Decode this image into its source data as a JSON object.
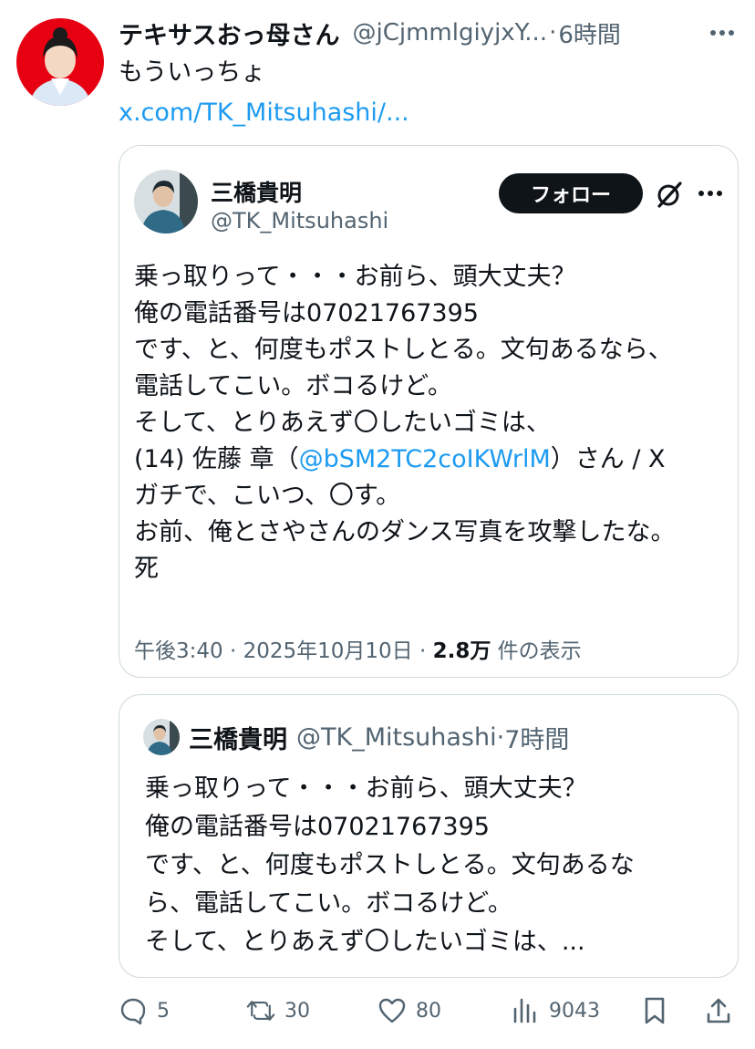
{
  "tweet": {
    "display_name": "テキサスおっ母さん",
    "handle": "@jCjmmlgiyjxY...",
    "time": "6時間",
    "text": "もういっちょ",
    "link": "x.com/TK_Mitsuhashi/..."
  },
  "embedded": {
    "display_name": "三橋貴明",
    "handle": "@TK_Mitsuhashi",
    "follow_label": "フォロー",
    "lines": [
      "乗っ取りって・・・お前ら、頭大丈夫？",
      "俺の電話番号は07021767395",
      "です、と、何度もポストしとる。文句あるなら、",
      "電話してこい。ボコるけど。",
      "そして、とりあえず〇したいゴミは、"
    ],
    "line6_prefix": "(14) 佐藤 章（",
    "mention": "@bSM2TC2coIKWrlM",
    "line6_suffix": "）さん / X",
    "lines_after": [
      "ガチで、こいつ、〇す。",
      "お前、俺とさやさんのダンス写真を攻撃したな。",
      "死"
    ],
    "meta_time": "午後3:40 · 2025年10月10日 · ",
    "meta_views": "2.8万",
    "meta_views_label": " 件の表示"
  },
  "quoted": {
    "display_name": "三橋貴明",
    "handle": "@TK_Mitsuhashi",
    "time": "7時間",
    "lines": [
      "乗っ取りって・・・お前ら、頭大丈夫？",
      "俺の電話番号は07021767395",
      "です、と、何度もポストしとる。文句あるな",
      "ら、電話してこい。ボコるけど。",
      "そして、とりあえず〇したいゴミは、..."
    ]
  },
  "actions": {
    "replies": "5",
    "reposts": "30",
    "likes": "80",
    "views": "9043"
  },
  "colors": {
    "link": "#1d9bf0",
    "secondary_text": "#536471",
    "border": "#cfd9de",
    "follow_bg": "#0f1419"
  },
  "icons": [
    "more-icon",
    "grok-icon",
    "reply-icon",
    "repost-icon",
    "like-icon",
    "views-icon",
    "bookmark-icon",
    "share-icon"
  ]
}
